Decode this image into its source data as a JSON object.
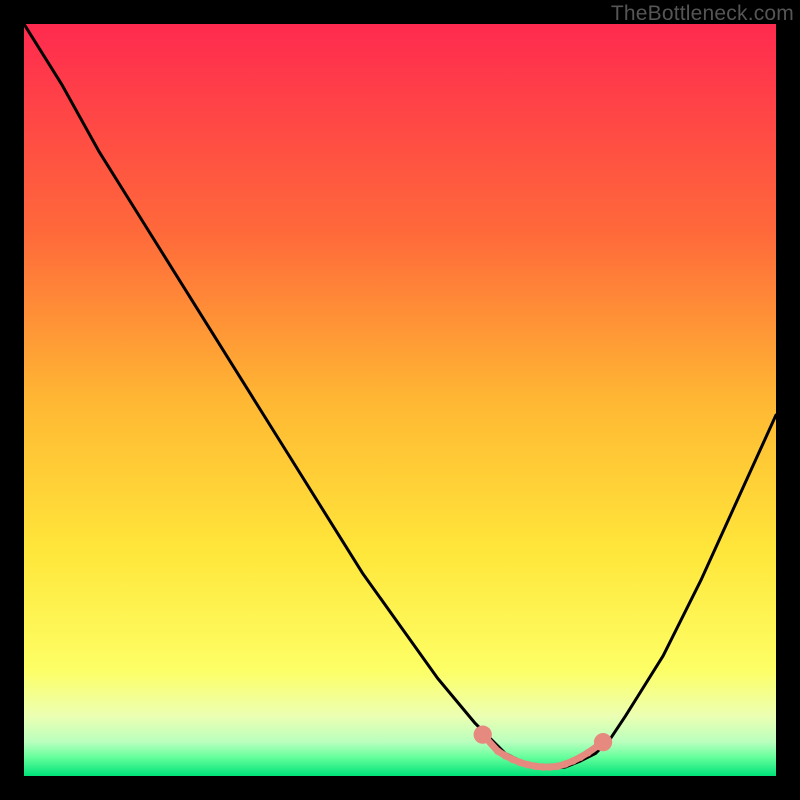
{
  "watermark": "TheBottleneck.com",
  "chart_data": {
    "type": "line",
    "title": "",
    "xlabel": "",
    "ylabel": "",
    "xlim": [
      0,
      100
    ],
    "ylim": [
      0,
      100
    ],
    "grid": false,
    "legend": false,
    "background_gradient": {
      "stops": [
        {
          "offset": 0.0,
          "color": "#ff2a4f"
        },
        {
          "offset": 0.28,
          "color": "#ff6a3a"
        },
        {
          "offset": 0.5,
          "color": "#ffb733"
        },
        {
          "offset": 0.7,
          "color": "#ffe63a"
        },
        {
          "offset": 0.86,
          "color": "#fdff66"
        },
        {
          "offset": 0.92,
          "color": "#ecffb2"
        },
        {
          "offset": 0.955,
          "color": "#b9ffbe"
        },
        {
          "offset": 0.975,
          "color": "#66ff9c"
        },
        {
          "offset": 1.0,
          "color": "#00e27a"
        }
      ]
    },
    "series": [
      {
        "name": "bottleneck-curve",
        "color": "#000000",
        "x": [
          0,
          5,
          10,
          15,
          20,
          25,
          30,
          35,
          40,
          45,
          50,
          55,
          60,
          62,
          64,
          66,
          68,
          70,
          72,
          74,
          76,
          78,
          80,
          85,
          90,
          95,
          100
        ],
        "y": [
          100,
          92,
          83,
          75,
          67,
          59,
          51,
          43,
          35,
          27,
          20,
          13,
          7,
          5,
          3,
          2,
          1.2,
          1,
          1.2,
          2,
          3,
          5,
          8,
          16,
          26,
          37,
          48
        ]
      }
    ],
    "markers": {
      "name": "bottom-dots",
      "color": "#e6897f",
      "dot_radius_pct": 0.9,
      "line_width_pct": 0.9,
      "x": [
        61,
        63,
        64,
        65,
        66,
        67,
        68,
        69,
        70,
        71,
        72,
        73,
        74,
        75,
        77
      ],
      "y": [
        5.5,
        3.3,
        2.7,
        2.2,
        1.8,
        1.5,
        1.3,
        1.2,
        1.2,
        1.3,
        1.6,
        2.0,
        2.5,
        3.1,
        4.5
      ]
    }
  }
}
